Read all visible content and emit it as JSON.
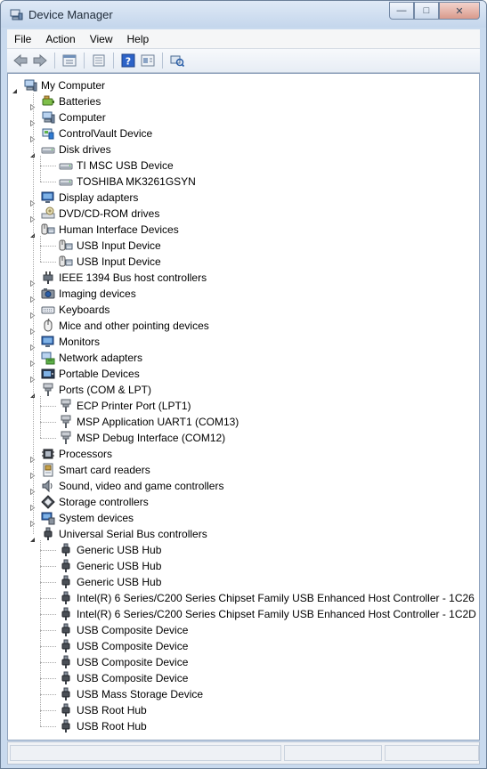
{
  "window": {
    "title": "Device Manager",
    "buttons": {
      "minimize": "minimize-icon",
      "maximize": "maximize-icon",
      "close": "close-icon"
    }
  },
  "menu": [
    "File",
    "Action",
    "View",
    "Help"
  ],
  "toolbar": [
    "back-arrow-icon",
    "forward-arrow-icon",
    "properties-icon",
    "show-hidden-icon",
    "help-icon",
    "update-driver-icon",
    "scan-hardware-icon"
  ],
  "tree": [
    {
      "label": "My Computer",
      "icon": "computer-icon",
      "level": 0,
      "expanded": true
    },
    {
      "label": "Batteries",
      "icon": "battery-icon",
      "level": 1,
      "expanded": false
    },
    {
      "label": "Computer",
      "icon": "computer-icon",
      "level": 1,
      "expanded": false
    },
    {
      "label": "ControlVault Device",
      "icon": "device-icon",
      "level": 1,
      "expanded": false
    },
    {
      "label": "Disk drives",
      "icon": "disk-icon",
      "level": 1,
      "expanded": true
    },
    {
      "label": "TI MSC USB Device",
      "icon": "disk-icon",
      "level": 2
    },
    {
      "label": "TOSHIBA MK3261GSYN",
      "icon": "disk-icon",
      "level": 2
    },
    {
      "label": "Display adapters",
      "icon": "monitor-icon",
      "level": 1,
      "expanded": false
    },
    {
      "label": "DVD/CD-ROM drives",
      "icon": "dvd-icon",
      "level": 1,
      "expanded": false
    },
    {
      "label": "Human Interface Devices",
      "icon": "hid-icon",
      "level": 1,
      "expanded": true
    },
    {
      "label": "USB Input Device",
      "icon": "hid-icon",
      "level": 2
    },
    {
      "label": "USB Input Device",
      "icon": "hid-icon",
      "level": 2
    },
    {
      "label": "IEEE 1394 Bus host controllers",
      "icon": "plug-icon",
      "level": 1,
      "expanded": false
    },
    {
      "label": "Imaging devices",
      "icon": "camera-icon",
      "level": 1,
      "expanded": false
    },
    {
      "label": "Keyboards",
      "icon": "keyboard-icon",
      "level": 1,
      "expanded": false
    },
    {
      "label": "Mice and other pointing devices",
      "icon": "mouse-icon",
      "level": 1,
      "expanded": false
    },
    {
      "label": "Monitors",
      "icon": "monitor-icon",
      "level": 1,
      "expanded": false
    },
    {
      "label": "Network adapters",
      "icon": "network-icon",
      "level": 1,
      "expanded": false
    },
    {
      "label": "Portable Devices",
      "icon": "portable-icon",
      "level": 1,
      "expanded": false
    },
    {
      "label": "Ports (COM & LPT)",
      "icon": "port-icon",
      "level": 1,
      "expanded": true
    },
    {
      "label": "ECP Printer Port (LPT1)",
      "icon": "port-icon",
      "level": 2
    },
    {
      "label": "MSP Application UART1 (COM13)",
      "icon": "port-icon",
      "level": 2
    },
    {
      "label": "MSP Debug Interface (COM12)",
      "icon": "port-icon",
      "level": 2
    },
    {
      "label": "Processors",
      "icon": "processor-icon",
      "level": 1,
      "expanded": false
    },
    {
      "label": "Smart card readers",
      "icon": "smartcard-icon",
      "level": 1,
      "expanded": false
    },
    {
      "label": "Sound, video and game controllers",
      "icon": "speaker-icon",
      "level": 1,
      "expanded": false
    },
    {
      "label": "Storage controllers",
      "icon": "storage-icon",
      "level": 1,
      "expanded": false
    },
    {
      "label": "System devices",
      "icon": "system-icon",
      "level": 1,
      "expanded": false
    },
    {
      "label": "Universal Serial Bus controllers",
      "icon": "usb-icon",
      "level": 1,
      "expanded": true
    },
    {
      "label": "Generic USB Hub",
      "icon": "usb-icon",
      "level": 2
    },
    {
      "label": "Generic USB Hub",
      "icon": "usb-icon",
      "level": 2
    },
    {
      "label": "Generic USB Hub",
      "icon": "usb-icon",
      "level": 2
    },
    {
      "label": "Intel(R) 6 Series/C200 Series Chipset Family USB Enhanced Host Controller - 1C26",
      "icon": "usb-icon",
      "level": 2
    },
    {
      "label": "Intel(R) 6 Series/C200 Series Chipset Family USB Enhanced Host Controller - 1C2D",
      "icon": "usb-icon",
      "level": 2
    },
    {
      "label": "USB Composite Device",
      "icon": "usb-icon",
      "level": 2
    },
    {
      "label": "USB Composite Device",
      "icon": "usb-icon",
      "level": 2
    },
    {
      "label": "USB Composite Device",
      "icon": "usb-icon",
      "level": 2
    },
    {
      "label": "USB Composite Device",
      "icon": "usb-icon",
      "level": 2
    },
    {
      "label": "USB Mass Storage Device",
      "icon": "usb-icon",
      "level": 2
    },
    {
      "label": "USB Root Hub",
      "icon": "usb-icon",
      "level": 2
    },
    {
      "label": "USB Root Hub",
      "icon": "usb-icon",
      "level": 2
    }
  ]
}
